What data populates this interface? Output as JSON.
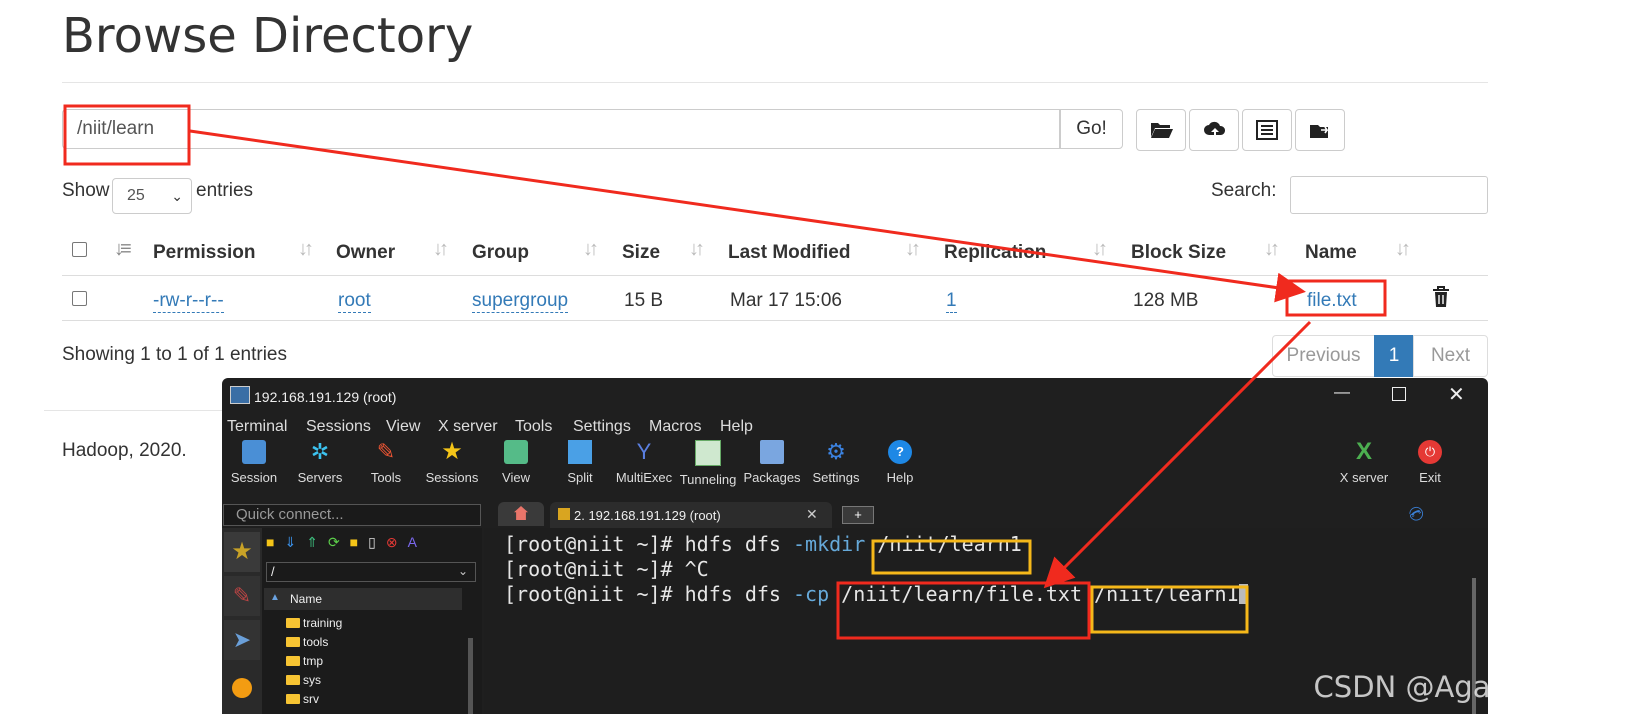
{
  "page": {
    "title": "Browse Directory",
    "path_value": "/niit/learn",
    "go_label": "Go!",
    "show_label": "Show",
    "entries_label": "entries",
    "length_value": "25",
    "search_label": "Search:",
    "columns": [
      "Permission",
      "Owner",
      "Group",
      "Size",
      "Last Modified",
      "Replication",
      "Block Size",
      "Name"
    ],
    "row": {
      "permission": "-rw-r--r--",
      "owner": "root",
      "group": "supergroup",
      "size": "15 B",
      "last_modified": "Mar 17 15:06",
      "replication": "1",
      "block_size": "128 MB",
      "name": "file.txt"
    },
    "info": "Showing 1 to 1 of 1 entries",
    "pager": {
      "previous": "Previous",
      "current": "1",
      "next": "Next"
    },
    "footer": "Hadoop, 2020.",
    "toolbar_icons": [
      "folder-open-icon",
      "upload-icon",
      "list-icon",
      "move-icon"
    ]
  },
  "terminal_window": {
    "title": "192.168.191.129 (root)",
    "menu": [
      "Terminal",
      "Sessions",
      "View",
      "X server",
      "Tools",
      "Settings",
      "Macros",
      "Help"
    ],
    "toolbar": [
      "Session",
      "Servers",
      "Tools",
      "Sessions",
      "View",
      "Split",
      "MultiExec",
      "Tunneling",
      "Packages",
      "Settings",
      "Help"
    ],
    "toolbar_right": [
      "X server",
      "Exit"
    ],
    "quick_connect": "Quick connect...",
    "tab_label": "2. 192.168.191.129 (root)",
    "tab_add": "+",
    "sidebar_path": "/",
    "tree_header": "Name",
    "tree_items": [
      "training",
      "tools",
      "tmp",
      "sys",
      "srv"
    ],
    "lines": [
      {
        "prompt": "[root@niit ~]# ",
        "cmd": "hdfs dfs ",
        "flag": "-mkdir",
        "arg1": "/niit/learn1",
        "arg2": ""
      },
      {
        "prompt": "[root@niit ~]# ",
        "cmd": "^C",
        "flag": "",
        "arg1": "",
        "arg2": ""
      },
      {
        "prompt": "[root@niit ~]# ",
        "cmd": "hdfs dfs ",
        "flag": "-cp",
        "arg1": "/niit/learn/file.txt",
        "arg2": "/niit/learn1"
      }
    ]
  },
  "watermark": "CSDN @Agatha方艺璇",
  "colors": {
    "annotation_red": "#f02a1e",
    "annotation_yellow": "#f5b81a",
    "link_blue": "#337ab7",
    "pager_active": "#337ab7"
  }
}
